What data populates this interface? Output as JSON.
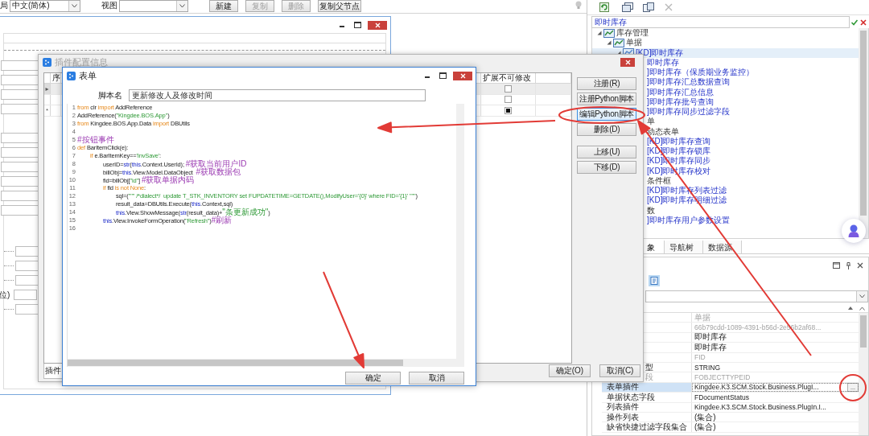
{
  "toolbar": {
    "language_label": "局",
    "language": "中文(简体)",
    "view_label": "视图",
    "buttons": [
      {
        "label": "新建",
        "disabled": false
      },
      {
        "label": "复制",
        "disabled": true
      },
      {
        "label": "删除",
        "disabled": true
      },
      {
        "label": "复制父节点",
        "disabled": false
      }
    ]
  },
  "designer": {
    "unit_label": "位)"
  },
  "plugin_window": {
    "title": "插件配置信息",
    "active": false,
    "table": {
      "columns": [
        "序",
        "扩展不可修改"
      ],
      "rows": [
        {
          "marker": "▸",
          "locked": false,
          "selected": true
        },
        {
          "locked": false,
          "selected": false
        },
        {
          "marker": "*",
          "locked": true,
          "selected": false
        }
      ]
    },
    "side_buttons": [
      [
        {
          "label": "注册(R)",
          "focused": false
        },
        {
          "label": "注册Python脚本",
          "focused": false
        },
        {
          "label": "编辑Python脚本",
          "focused": true
        },
        {
          "label": "删除(D)",
          "focused": false
        }
      ],
      [
        {
          "label": "上移(U)",
          "focused": false
        },
        {
          "label": "下移(D)",
          "focused": false
        }
      ]
    ],
    "tab": "插件",
    "buttons": [
      "确定(O)",
      "取消(C)"
    ]
  },
  "form_window": {
    "title": "表单",
    "script_name_label": "脚本名",
    "script_name": "更新修改人及修改时间",
    "code": [
      {
        "number": "1",
        "tokens": [
          {
            "kind": "keyword",
            "text": "from"
          },
          {
            "kind": "plain",
            "text": " clr "
          },
          {
            "kind": "keyword",
            "text": "import"
          },
          {
            "kind": "plain",
            "text": " AddReference"
          }
        ]
      },
      {
        "number": "2",
        "tokens": [
          {
            "kind": "plain",
            "text": "AddReference("
          },
          {
            "kind": "string",
            "text": "\"Kingdee.BOS.App\""
          },
          {
            "kind": "plain",
            "text": ")"
          }
        ]
      },
      {
        "number": "3",
        "tokens": [
          {
            "kind": "keyword",
            "text": "from"
          },
          {
            "kind": "plain",
            "text": " Kingdee.BOS.App.Data "
          },
          {
            "kind": "keyword",
            "text": "import"
          },
          {
            "kind": "plain",
            "text": " DBUtils"
          }
        ]
      },
      {
        "number": "4"
      },
      {
        "number": "5",
        "tokens": [
          {
            "kind": "comment",
            "text": "#按钮事件"
          }
        ]
      },
      {
        "number": "6",
        "tokens": [
          {
            "kind": "keyword",
            "text": "def"
          },
          {
            "kind": "plain",
            "text": " BarItemClick(e):"
          }
        ]
      },
      {
        "number": "7",
        "tokens": [
          {
            "kind": "keyword",
            "text": "\tif"
          },
          {
            "kind": "plain",
            "text": " e.BarItemKey=="
          },
          {
            "kind": "string",
            "text": "'InvSave'"
          },
          {
            "kind": "plain",
            "text": ":"
          }
        ]
      },
      {
        "number": "8",
        "tokens": [
          {
            "kind": "plain",
            "text": "\t\tuserID="
          },
          {
            "kind": "builtin",
            "text": "str"
          },
          {
            "kind": "plain",
            "text": "("
          },
          {
            "kind": "builtin",
            "text": "this"
          },
          {
            "kind": "plain",
            "text": ".Context.UserId); "
          },
          {
            "kind": "comment",
            "text": "#获取当前用户ID"
          }
        ]
      },
      {
        "number": "9",
        "tokens": [
          {
            "kind": "plain",
            "text": "\t\tbillObj="
          },
          {
            "kind": "builtin",
            "text": "this"
          },
          {
            "kind": "plain",
            "text": ".View.Model.DataObject  "
          },
          {
            "kind": "comment",
            "text": "#获取数据包"
          }
        ]
      },
      {
        "number": "10",
        "tokens": [
          {
            "kind": "plain",
            "text": "\t\tfid=billObj["
          },
          {
            "kind": "string",
            "text": "\"id\""
          },
          {
            "kind": "plain",
            "text": "] "
          },
          {
            "kind": "comment",
            "text": "#获取单据内码"
          }
        ]
      },
      {
        "number": "11",
        "tokens": [
          {
            "kind": "keyword",
            "text": "\t\tif"
          },
          {
            "kind": "plain",
            "text": " fid "
          },
          {
            "kind": "keyword",
            "text": "is not None"
          },
          {
            "kind": "plain",
            "text": ":"
          }
        ]
      },
      {
        "number": "12",
        "tokens": [
          {
            "kind": "plain",
            "text": "\t\t\tsql=("
          },
          {
            "kind": "string",
            "text": "\"\"\" /*dialect*/  update T_STK_INVENTORY set FUPDATETIME=GETDATE(),ModifyUser='{0}' where FID='{1}' \"\"\""
          },
          {
            "kind": "plain",
            "text": ")"
          }
        ]
      },
      {
        "number": "13",
        "tokens": [
          {
            "kind": "plain",
            "text": "\t\t\tresult_data=DBUtils.Execute("
          },
          {
            "kind": "builtin",
            "text": "this"
          },
          {
            "kind": "plain",
            "text": ".Context,sql)"
          }
        ]
      },
      {
        "number": "14",
        "tokens": [
          {
            "kind": "builtin",
            "text": "\t\t\tthis"
          },
          {
            "kind": "plain",
            "text": ".View.ShowMessage("
          },
          {
            "kind": "builtin",
            "text": "str"
          },
          {
            "kind": "plain",
            "text": "(result_data)+"
          },
          {
            "kind": "string",
            "text": "\"条更新成功\""
          },
          {
            "kind": "plain",
            "text": ")"
          }
        ]
      },
      {
        "number": "15",
        "tokens": [
          {
            "kind": "builtin",
            "text": "\t\tthis"
          },
          {
            "kind": "plain",
            "text": ".View.InvokeFormOperation("
          },
          {
            "kind": "string",
            "text": "\"Refresh\""
          },
          {
            "kind": "plain",
            "text": ")"
          },
          {
            "kind": "comment",
            "text": "#刷新"
          }
        ]
      },
      {
        "number": "16"
      }
    ],
    "buttons": [
      "确定",
      "取消"
    ]
  },
  "right_panel": {
    "search": "即时库存",
    "tree": [
      {
        "label": "库存管理",
        "kind": "group",
        "selected": false,
        "expanded": true,
        "children": [
          {
            "label": "单据",
            "kind": "group",
            "selected": false,
            "expanded": true,
            "children": [
              {
                "label": "[KD]即时库存",
                "kind": "form",
                "selected": true,
                "expanded": true
              },
              {
                "label": "即时库存",
                "kind": "form",
                "selected": false,
                "clipped": true
              },
              {
                "label": "]即时库存（保质期业务监控）",
                "kind": "form",
                "selected": false,
                "clipped": true
              },
              {
                "label": "]即时库存汇总数据查询",
                "kind": "form",
                "selected": false,
                "clipped": true
              },
              {
                "label": "]即时库存汇总信息",
                "kind": "form",
                "selected": false,
                "clipped": true
              },
              {
                "label": "]即时库存批号查询",
                "kind": "form",
                "selected": false,
                "clipped": true
              },
              {
                "label": "]即时库存同步过滤字段",
                "kind": "form",
                "selected": false,
                "clipped": true
              }
            ]
          },
          {
            "label": "单",
            "kind": "group",
            "selected": false,
            "clipped": true
          },
          {
            "label": "动态表单",
            "kind": "group",
            "selected": false,
            "clipped": true
          },
          {
            "label": "[KD]即时库存查询",
            "kind": "form",
            "selected": false,
            "clipped": true
          },
          {
            "label": "[KD]即时库存锁库",
            "kind": "form",
            "selected": false,
            "clipped": true
          },
          {
            "label": "[KD]即时库存同步",
            "kind": "form",
            "selected": false,
            "clipped": true
          },
          {
            "label": "[KD]即时库存校对",
            "kind": "form",
            "selected": false,
            "clipped": true
          },
          {
            "label": "条件框",
            "kind": "group",
            "selected": false,
            "clipped": true
          },
          {
            "label": "[KD]即时库存列表过滤",
            "kind": "form",
            "selected": false,
            "clipped": true
          },
          {
            "label": "[KD]即时库存明细过滤",
            "kind": "form",
            "selected": false,
            "clipped": true
          },
          {
            "label": "数",
            "kind": "group",
            "selected": false,
            "clipped": true
          },
          {
            "label": "]即时库存用户参数设置",
            "kind": "form",
            "selected": false,
            "clipped": true
          }
        ]
      }
    ],
    "tabs": [
      {
        "label": "象",
        "selected": true
      },
      {
        "label": "导航树",
        "selected": false
      },
      {
        "label": "数据源",
        "selected": false
      }
    ],
    "properties": [
      {
        "value": "单据",
        "disabled": true,
        "selected": false
      },
      {
        "value": "66b79cdd-1089-4391-b56d-2e56b2af68...",
        "disabled": true,
        "selected": false
      },
      {
        "value": "即时库存",
        "disabled": false,
        "selected": false
      },
      {
        "value": "即时库存",
        "disabled": false,
        "selected": false
      },
      {
        "value": "FID",
        "disabled": true,
        "selected": false
      },
      {
        "name": "型",
        "clipped": true,
        "value": "STRING",
        "disabled": false,
        "selected": false
      },
      {
        "name": "段",
        "clipped": true,
        "value": "FOBJECTTYPEID",
        "disabled": true,
        "selected": false
      },
      {
        "name": "表单插件",
        "value": "Kingdee.K3.SCM.Stock.Business.PlugI...",
        "action": "...",
        "disabled": false,
        "selected": true
      },
      {
        "name": "单据状态字段",
        "value": "FDocumentStatus",
        "disabled": false,
        "selected": false
      },
      {
        "name": "列表插件",
        "value": "Kingdee.K3.SCM.Stock.Business.PlugIn.I...",
        "disabled": false,
        "selected": false
      },
      {
        "name": "操作列表",
        "value": "(集合)",
        "disabled": false,
        "selected": false
      },
      {
        "name": "缺省快捷过滤字段集合",
        "value": "(集合)",
        "disabled": false,
        "selected": false
      }
    ]
  },
  "annotations": [
    {
      "kind": "arrow"
    },
    {
      "kind": "arrow"
    },
    {
      "kind": "arrow"
    },
    {
      "kind": "ring"
    },
    {
      "kind": "ring"
    }
  ]
}
